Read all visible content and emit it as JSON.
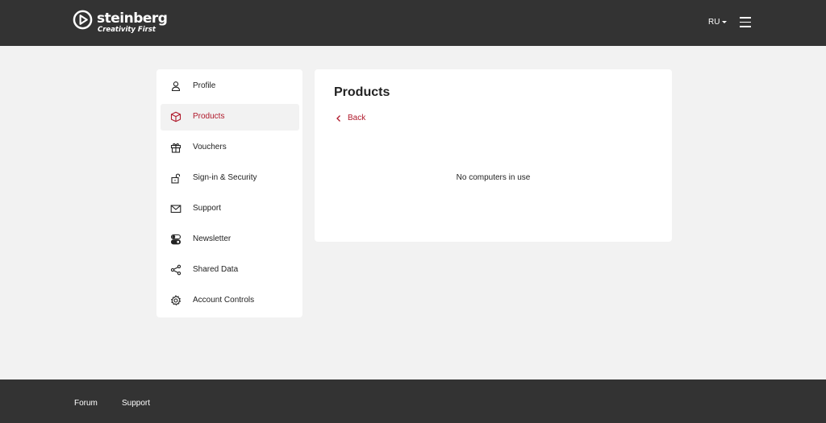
{
  "header": {
    "brand_name": "steinberg",
    "brand_tagline": "Creativity First",
    "language": "RU",
    "icons": {
      "logo": "play-circle-icon",
      "menu": "hamburger-menu-icon",
      "language_caret": "caret-down-icon"
    }
  },
  "sidebar": {
    "items": [
      {
        "label": "Profile",
        "icon": "user-icon",
        "active": false
      },
      {
        "label": "Products",
        "icon": "box-icon",
        "active": true
      },
      {
        "label": "Vouchers",
        "icon": "gift-icon",
        "active": false
      },
      {
        "label": "Sign-in & Security",
        "icon": "lock-icon",
        "active": false
      },
      {
        "label": "Support",
        "icon": "envelope-icon",
        "active": false
      },
      {
        "label": "Newsletter",
        "icon": "toggle-icon",
        "active": false
      },
      {
        "label": "Shared Data",
        "icon": "share-icon",
        "active": false
      },
      {
        "label": "Account Controls",
        "icon": "gear-icon",
        "active": false
      }
    ]
  },
  "main": {
    "title": "Products",
    "back_label": "Back",
    "empty_message": "No computers in use"
  },
  "footer": {
    "links": [
      "Forum",
      "Support"
    ]
  },
  "colors": {
    "header_bg": "#333333",
    "page_bg": "#f2f2f2",
    "accent": "#b0182a",
    "card_bg": "#ffffff"
  }
}
